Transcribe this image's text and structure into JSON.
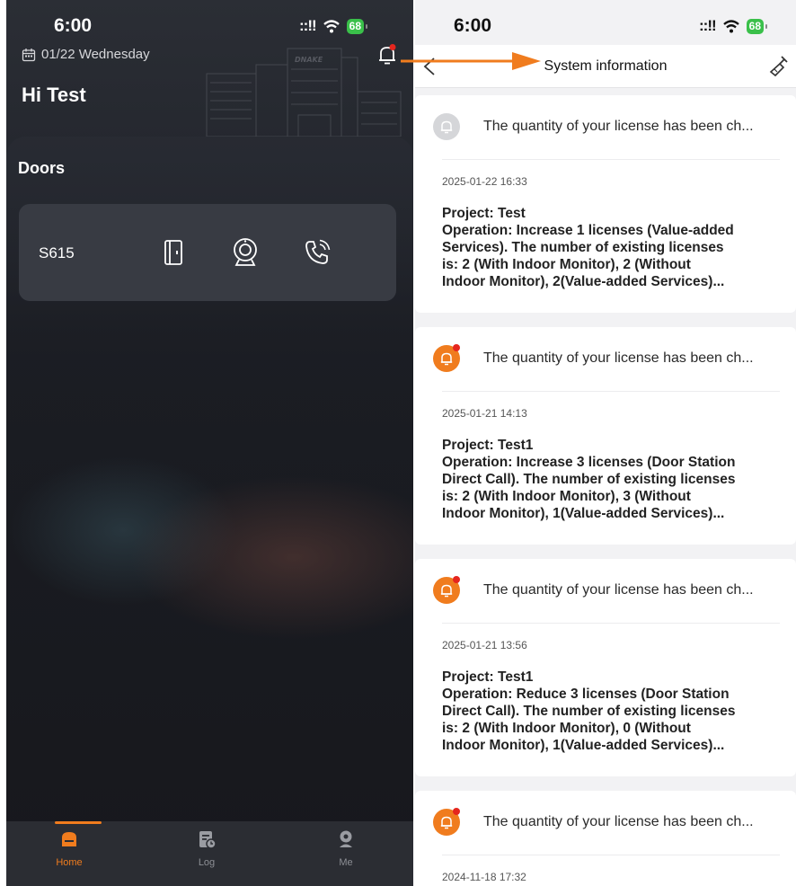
{
  "left_phone": {
    "status_bar": {
      "time": "6:00",
      "battery": "68"
    },
    "date": "01/22 Wednesday",
    "greeting": "Hi Test",
    "icons": {
      "calendar": "calendar-icon",
      "bell": "bell-icon"
    },
    "notification_badge_color": "#e5261e",
    "doors": {
      "title": "Doors",
      "items": [
        {
          "name": "S615",
          "actions": [
            "door-unlock-icon",
            "camera-icon",
            "phone-call-icon"
          ]
        }
      ]
    },
    "tabs": [
      {
        "label": "Home",
        "icon": "home-icon",
        "active": true
      },
      {
        "label": "Log",
        "icon": "log-icon",
        "active": false
      },
      {
        "label": "Me",
        "icon": "user-icon",
        "active": false
      }
    ],
    "accent_color": "#f07c1e"
  },
  "right_phone": {
    "status_bar": {
      "time": "6:00",
      "battery": "68"
    },
    "title": "System information",
    "icons": {
      "back": "back-icon",
      "clear": "clear-broom-icon"
    },
    "messages": [
      {
        "subject": "The quantity of your license has been ch...",
        "time": "2025-01-22 16:33",
        "read": true,
        "body": [
          "Project: Test",
          "Operation: Increase 1 licenses (Value-added",
          "Services). The number of existing licenses",
          "is: 2 (With Indoor Monitor), 2 (Without",
          "Indoor Monitor), 2(Value-added Services)..."
        ]
      },
      {
        "subject": "The quantity of your license has been ch...",
        "time": "2025-01-21 14:13",
        "read": false,
        "body": [
          "Project: Test1",
          "Operation: Increase 3 licenses (Door Station",
          "Direct Call). The number of existing licenses",
          "is: 2 (With Indoor Monitor), 3 (Without",
          "Indoor Monitor), 1(Value-added Services)..."
        ]
      },
      {
        "subject": "The quantity of your license has been ch...",
        "time": "2025-01-21 13:56",
        "read": false,
        "body": [
          "Project: Test1",
          "Operation: Reduce 3 licenses (Door Station",
          "Direct Call). The number of existing licenses",
          "is: 2 (With Indoor Monitor), 0 (Without",
          "Indoor Monitor), 1(Value-added Services)..."
        ]
      },
      {
        "subject": "The quantity of your license has been ch...",
        "time": "2024-11-18 17:32",
        "read": false,
        "body": []
      }
    ]
  },
  "annotation": {
    "arrow_color": "#f07c1e"
  }
}
